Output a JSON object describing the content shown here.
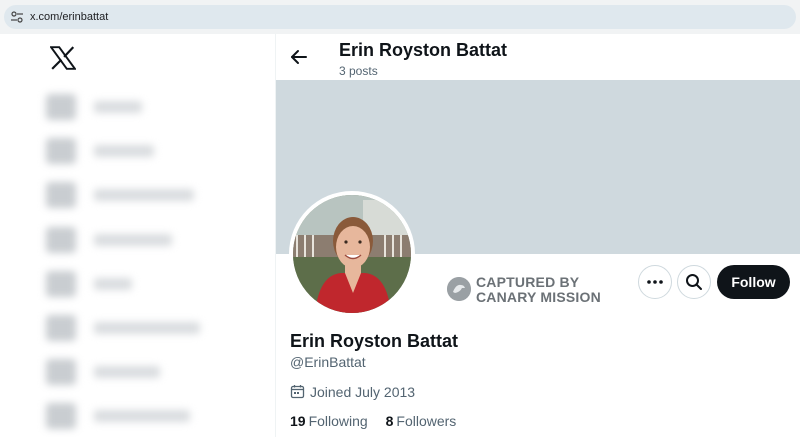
{
  "browser": {
    "url": "x.com/erinbattat"
  },
  "header": {
    "name": "Erin Royston Battat",
    "posts": "3 posts"
  },
  "stamp": {
    "line1": "CAPTURED BY",
    "line2": "CANARY MISSION"
  },
  "actions": {
    "follow": "Follow"
  },
  "profile": {
    "name": "Erin Royston Battat",
    "handle": "@ErinBattat",
    "joined": "Joined July 2013",
    "following_count": "19",
    "following_label": "Following",
    "followers_count": "8",
    "followers_label": "Followers"
  },
  "colors": {
    "banner": "#cfd9de",
    "follow_bg": "#0f1419",
    "muted": "#536471"
  }
}
